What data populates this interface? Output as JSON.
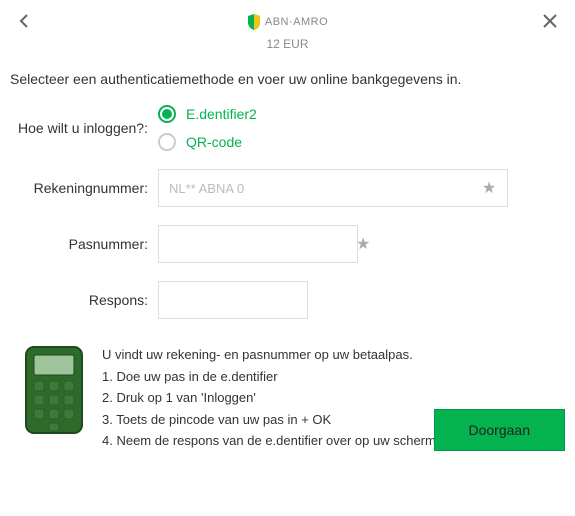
{
  "header": {
    "bank_name": "ABN·AMRO",
    "amount": "12 EUR"
  },
  "instruction": "Selecteer een authenticatiemethode en voer uw online bankgegevens in.",
  "login_method": {
    "label": "Hoe wilt u inloggen?:",
    "options": [
      {
        "label": "E.dentifier2",
        "selected": true
      },
      {
        "label": "QR-code",
        "selected": false
      }
    ]
  },
  "fields": {
    "account": {
      "label": "Rekeningnummer:",
      "prefix": "NL** ABNA 0",
      "value": ""
    },
    "card": {
      "label": "Pasnummer:",
      "value": ""
    },
    "response": {
      "label": "Respons:",
      "value": ""
    }
  },
  "instructions_block": {
    "intro": "U vindt uw rekening- en pasnummer op uw betaalpas.",
    "steps": [
      "1. Doe uw pas in de e.dentifier",
      "2. Druk op 1 van 'Inloggen'",
      "3. Toets de pincode van uw pas in + OK",
      "4. Neem de respons van de e.dentifier over op uw scherm"
    ]
  },
  "footer": {
    "continue": "Doorgaan"
  }
}
